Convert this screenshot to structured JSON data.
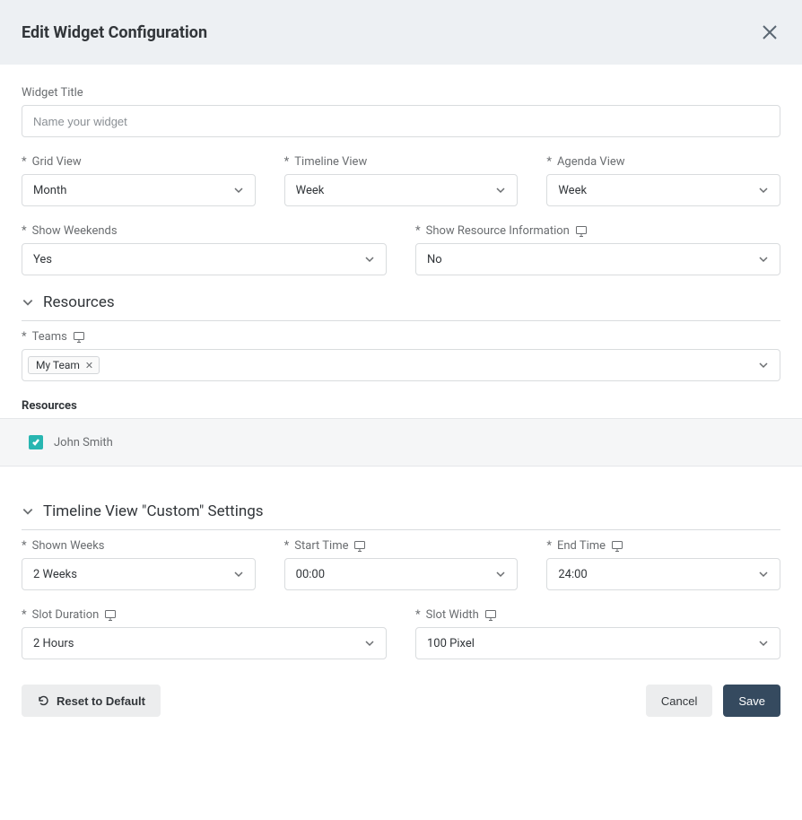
{
  "header": {
    "title": "Edit Widget Configuration"
  },
  "labels": {
    "widget_title": "Widget Title",
    "grid_view": "Grid View",
    "timeline_view": "Timeline View",
    "agenda_view": "Agenda View",
    "show_weekends": "Show Weekends",
    "show_resource_info": "Show Resource Information",
    "resources_section": "Resources",
    "teams": "Teams",
    "resources_list": "Resources",
    "timeline_settings_section": "Timeline View \"Custom\" Settings",
    "shown_weeks": "Shown Weeks",
    "start_time": "Start Time",
    "end_time": "End Time",
    "slot_duration": "Slot Duration",
    "slot_width": "Slot Width",
    "required_marker": "*"
  },
  "placeholders": {
    "widget_title": "Name your widget"
  },
  "values": {
    "widget_title": "",
    "grid_view": "Month",
    "timeline_view": "Week",
    "agenda_view": "Week",
    "show_weekends": "Yes",
    "show_resource_info": "No",
    "shown_weeks": "2 Weeks",
    "start_time": "00:00",
    "end_time": "24:00",
    "slot_duration": "2 Hours",
    "slot_width": "100 Pixel"
  },
  "teams": {
    "selected": [
      {
        "label": "My Team"
      }
    ]
  },
  "resources": {
    "items": [
      {
        "name": "John Smith",
        "checked": true
      }
    ]
  },
  "buttons": {
    "reset": "Reset to Default",
    "cancel": "Cancel",
    "save": "Save"
  }
}
